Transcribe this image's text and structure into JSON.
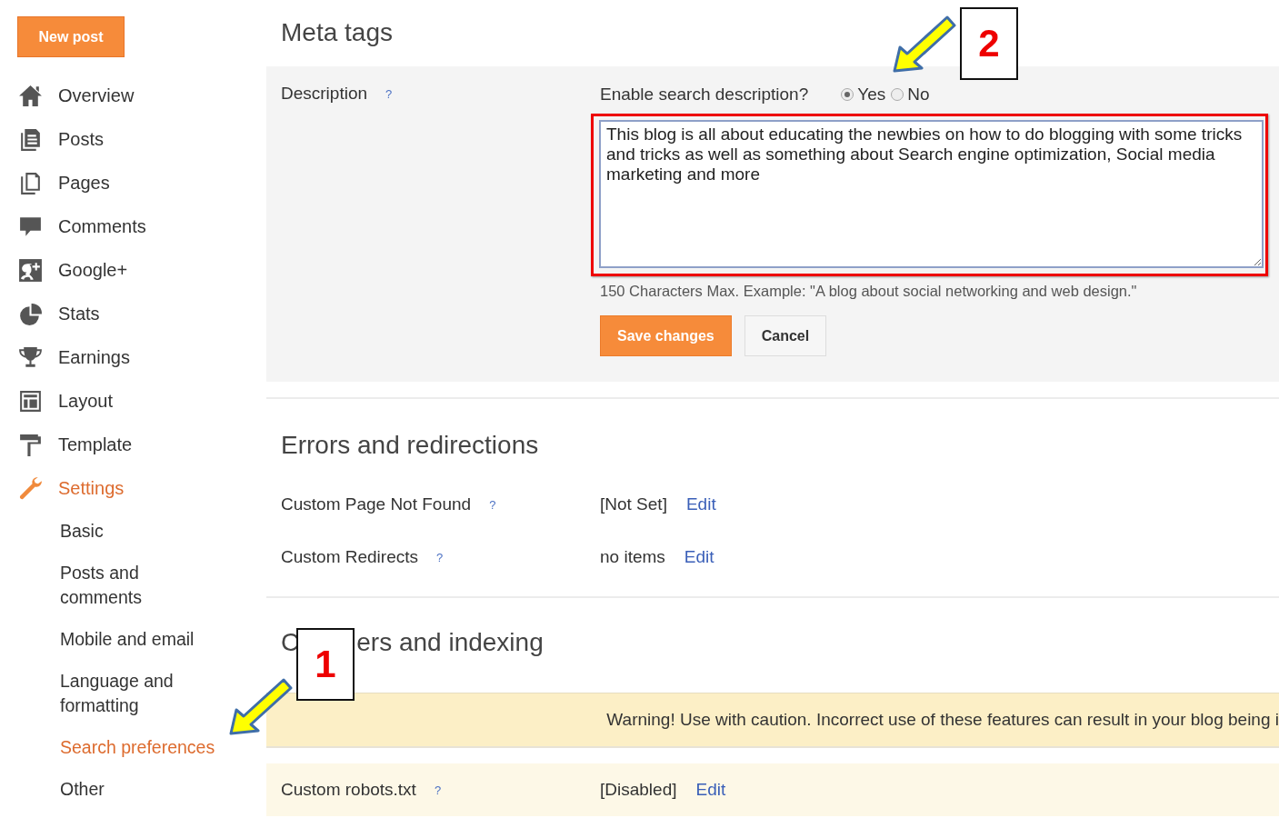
{
  "new_post_button": "New post",
  "sidebar": {
    "items": [
      {
        "label": "Overview",
        "selected": false
      },
      {
        "label": "Posts",
        "selected": false
      },
      {
        "label": "Pages",
        "selected": false
      },
      {
        "label": "Comments",
        "selected": false
      },
      {
        "label": "Google+",
        "selected": false
      },
      {
        "label": "Stats",
        "selected": false
      },
      {
        "label": "Earnings",
        "selected": false
      },
      {
        "label": "Layout",
        "selected": false
      },
      {
        "label": "Template",
        "selected": false
      },
      {
        "label": "Settings",
        "selected": true,
        "children": [
          {
            "label": "Basic",
            "selected": false
          },
          {
            "label": "Posts and comments",
            "selected": false
          },
          {
            "label": "Mobile and email",
            "selected": false
          },
          {
            "label": "Language and formatting",
            "selected": false
          },
          {
            "label": "Search preferences",
            "selected": true
          },
          {
            "label": "Other",
            "selected": false
          }
        ]
      }
    ]
  },
  "meta_tags": {
    "title": "Meta tags",
    "label": "Description",
    "help": "?",
    "question": "Enable search description?",
    "options": [
      {
        "label": "Yes",
        "selected": true
      },
      {
        "label": "No",
        "selected": false
      }
    ],
    "value": "This blog is all about educating the newbies on how to do blogging with some tricks and tricks as well as something about Search engine optimization, Social media marketing and more",
    "hint": "150 Characters Max. Example: \"A blog about social networking and web design.\"",
    "buttons": [
      {
        "label": "Save changes",
        "kind": "primary"
      },
      {
        "label": "Cancel",
        "kind": "secondary"
      }
    ]
  },
  "errors": {
    "title": "Errors and redirections",
    "rows": [
      {
        "label": "Custom Page Not Found",
        "help": "?",
        "value": "[Not Set]",
        "link": "Edit"
      },
      {
        "label": "Custom Redirects",
        "help": "?",
        "value": "no items",
        "link": "Edit"
      }
    ]
  },
  "crawlers": {
    "title_parts": [
      "C",
      "ers and indexing"
    ],
    "warning": "Warning! Use with caution. Incorrect use of these features can result in your blog being i",
    "rows": [
      {
        "label": "Custom robots.txt",
        "help": "?",
        "value": "[Disabled]",
        "link": "Edit"
      }
    ]
  },
  "callouts": [
    {
      "number": "2"
    },
    {
      "number": "1"
    }
  ]
}
